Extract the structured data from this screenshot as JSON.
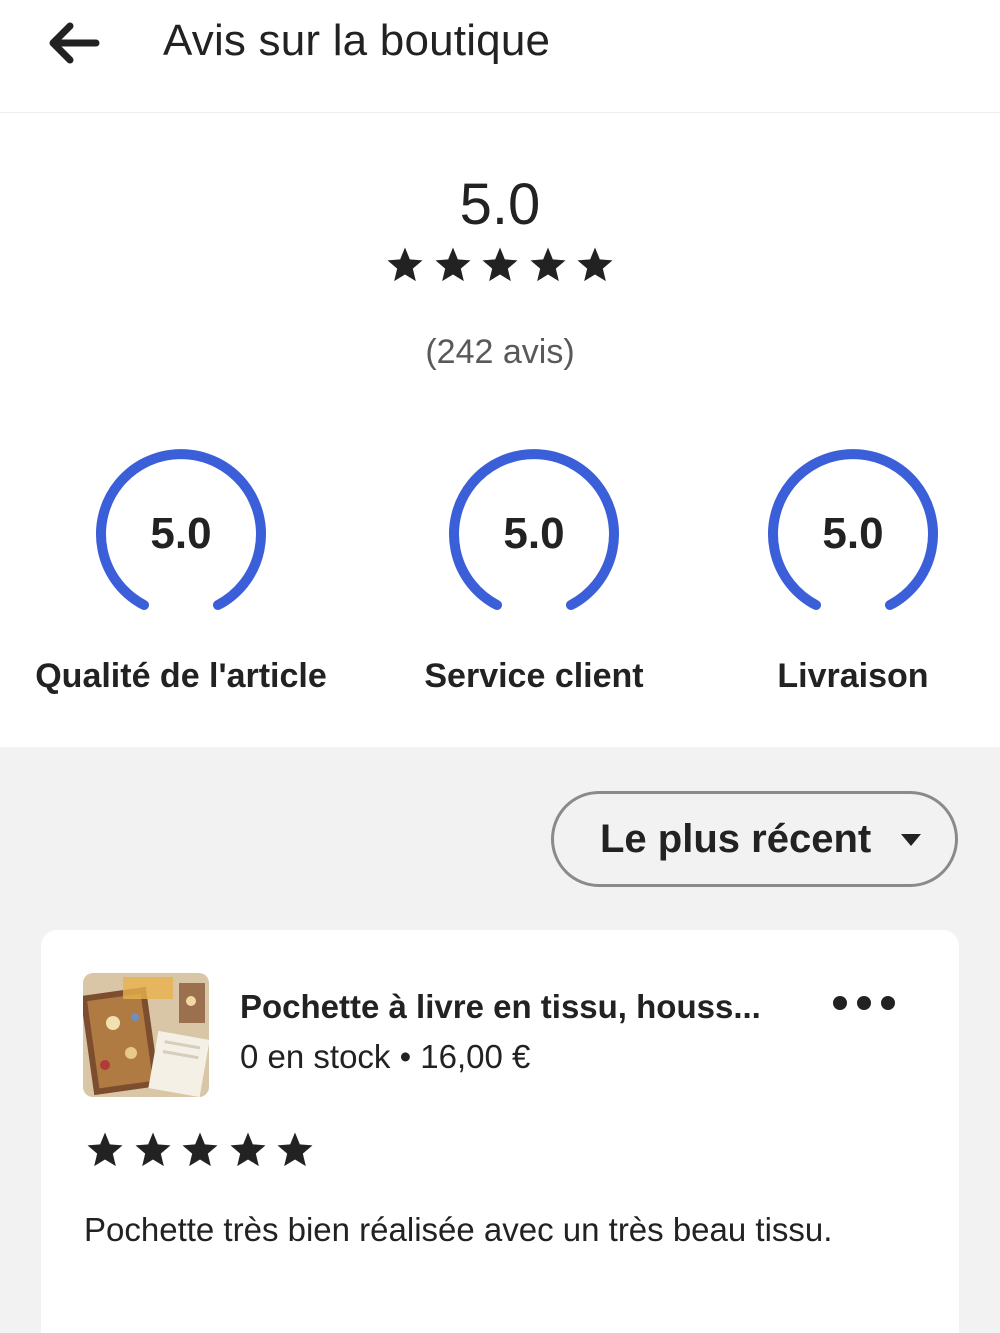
{
  "header": {
    "title": "Avis sur la boutique",
    "back_icon": "arrow-left-icon"
  },
  "summary": {
    "average": "5.0",
    "stars": 5,
    "count_text": "(242 avis)"
  },
  "gauges": [
    {
      "value": "5.0",
      "label": "Qualité de l'article",
      "fraction": 1.0
    },
    {
      "value": "5.0",
      "label": "Service client",
      "fraction": 1.0
    },
    {
      "value": "5.0",
      "label": "Livraison",
      "fraction": 1.0
    }
  ],
  "sort": {
    "label": "Le plus récent",
    "caret_icon": "caret-down-icon"
  },
  "review": {
    "item_title": "Pochette à livre en tissu, houss...",
    "item_meta": "0 en stock • 16,00 €",
    "stars": 5,
    "text": "Pochette très bien réalisée avec un très beau tissu.",
    "more_icon": "more-horizontal-icon"
  },
  "colors": {
    "accent": "#3b5fd9",
    "star": "#222222",
    "section_bg": "#f2f2f2"
  }
}
